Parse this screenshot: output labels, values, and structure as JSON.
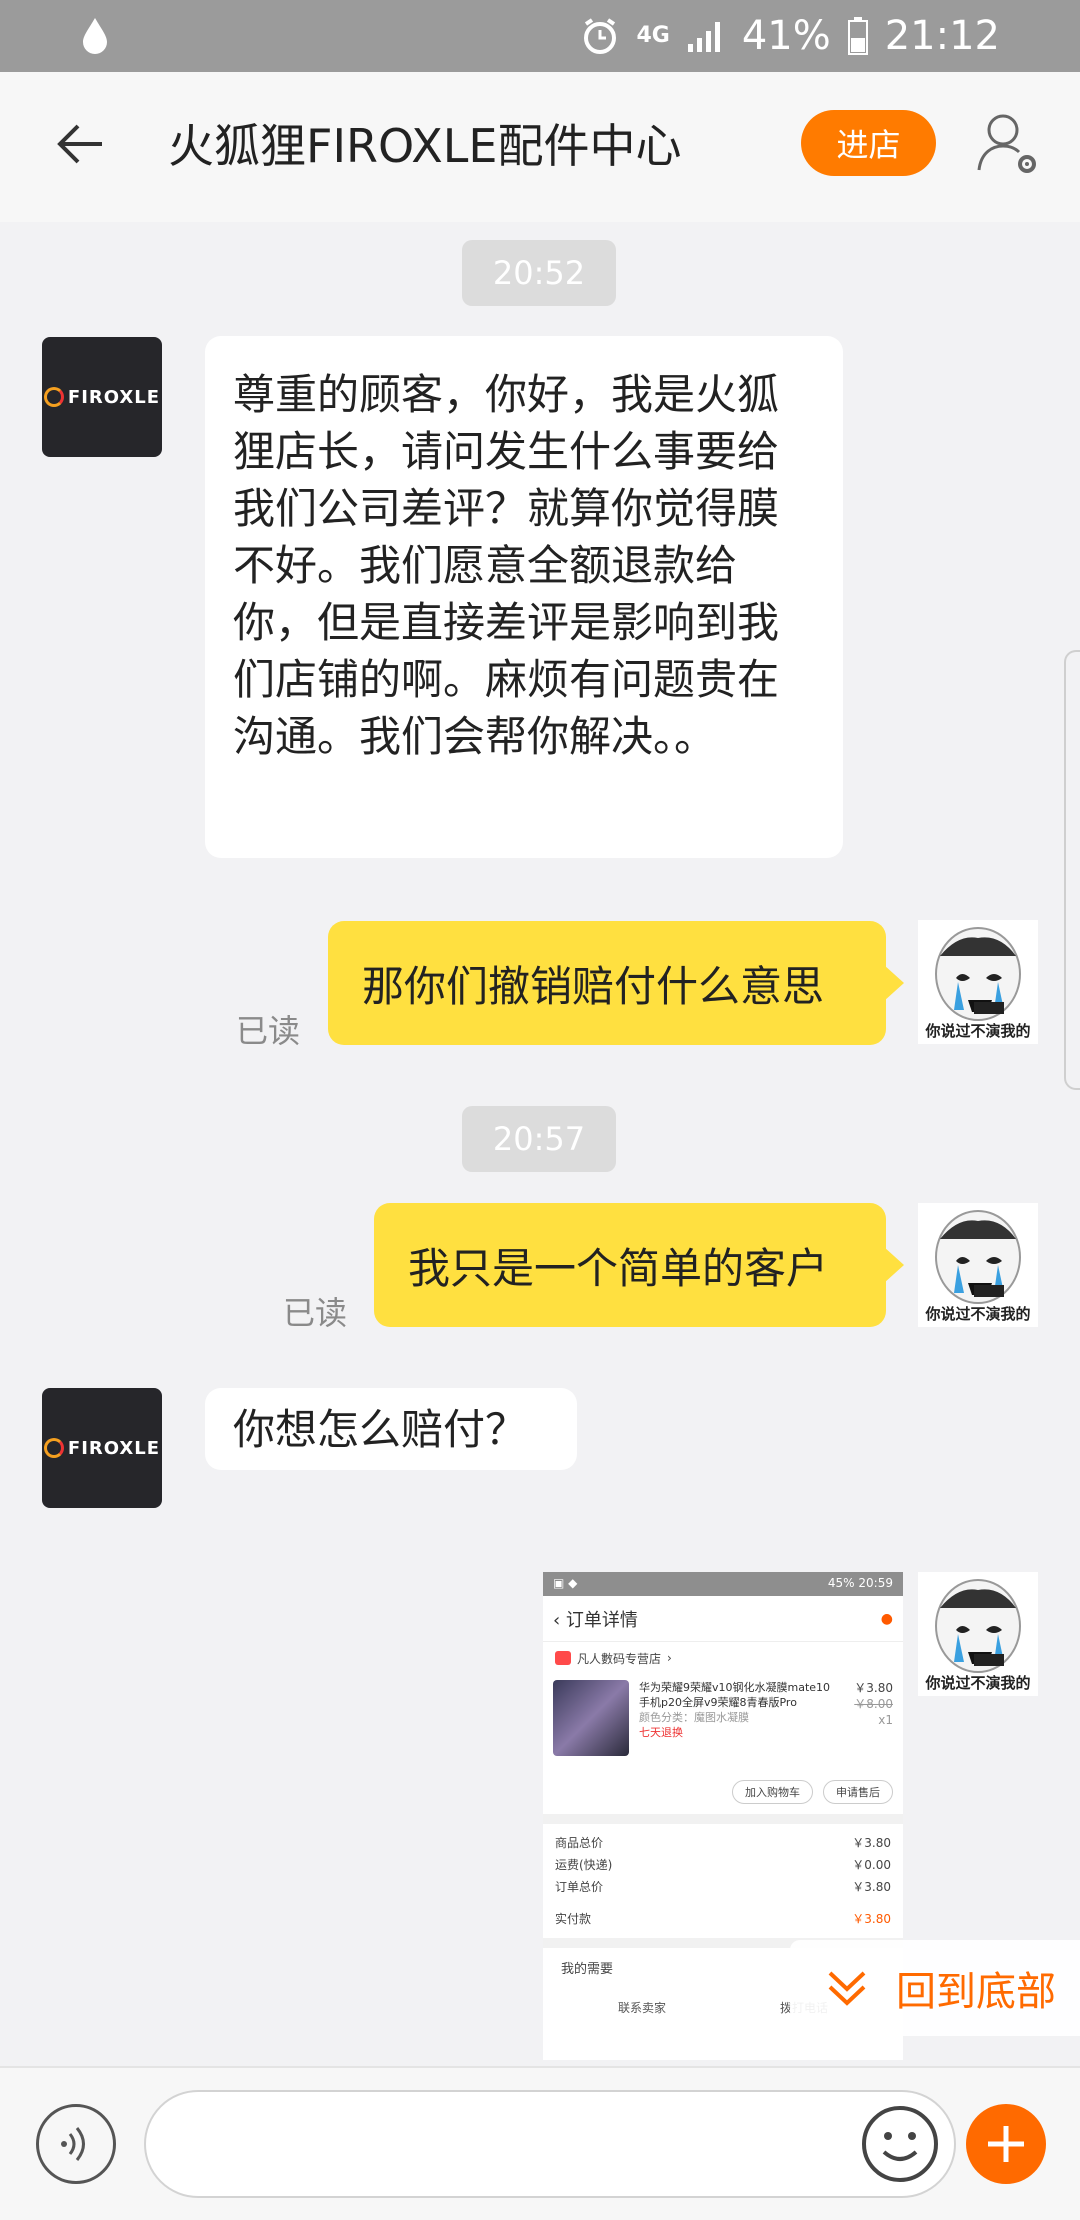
{
  "status_bar": {
    "network": "4G",
    "battery": "41%",
    "time": "21:12"
  },
  "header": {
    "title": "火狐狸FIROXLE配件中心",
    "enter_store": "进店",
    "icons": [
      "back-arrow-icon",
      "user-settings-icon"
    ]
  },
  "conversation": {
    "timestamps": [
      "20:52",
      "20:57"
    ],
    "shop_logo": "FIROXLE",
    "user_avatar_caption": "你说过不演我的",
    "messages": [
      {
        "from": "shop",
        "text": "尊重的顾客，你好，我是火狐狸店长，请问发生什么事要给我们公司差评？就算你觉得膜不好。我们愿意全额退款给你，但是直接差评是影响到我们店铺的啊。麻烦有问题贵在沟通。我们会帮你解决。。"
      },
      {
        "from": "me",
        "text": "那你们撤销赔付什么意思",
        "status": "已读"
      },
      {
        "from": "me",
        "text": "我只是一个简单的客户",
        "status": "已读"
      },
      {
        "from": "shop",
        "text": "你想怎么赔付？"
      },
      {
        "from": "me",
        "type": "image",
        "description": "order-detail-screenshot"
      }
    ]
  },
  "order_screenshot": {
    "status_time": "20:59",
    "status_battery": "45%",
    "title": "订单详情",
    "shop": "凡人數码专营店",
    "item_desc": "华为荣耀9荣耀v10钢化水凝膜mate10手机p20全屏v9荣耀8青春版Pro",
    "item_spec": "颜色分类：魔图水凝膜",
    "item_tag": "七天退换",
    "price": "￥3.80",
    "orig_price": "￥8.00",
    "qty": "x1",
    "buttons": [
      "加入购物车",
      "申请售后"
    ],
    "summary": [
      {
        "label": "商品总价",
        "value": "￥3.80"
      },
      {
        "label": "运费(快递)",
        "value": "￥0.00"
      },
      {
        "label": "订单总价",
        "value": "￥3.80"
      }
    ],
    "paid_label": "实付款",
    "paid_value": "￥3.80",
    "help_title": "我的需要",
    "help_links": [
      "联系卖家",
      "拨打电话"
    ]
  },
  "back_to_bottom": "回到底部",
  "input_bar": {
    "placeholder": "",
    "icons": [
      "voice-icon",
      "emoji-icon",
      "plus-icon"
    ]
  }
}
